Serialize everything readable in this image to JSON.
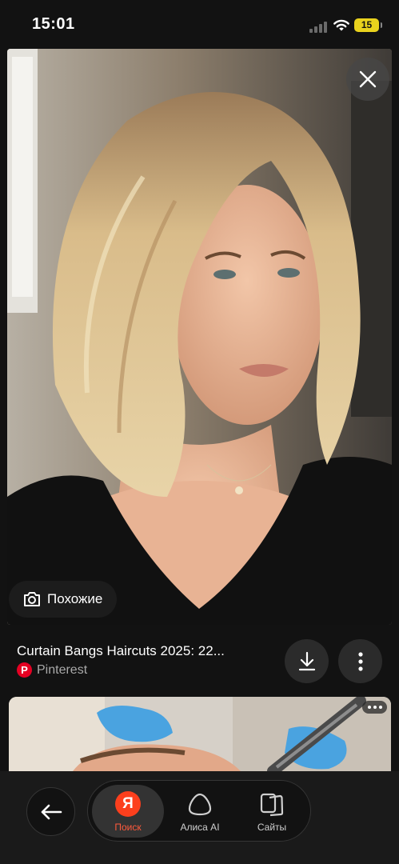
{
  "status_bar": {
    "time": "15:01",
    "battery": "15",
    "battery_color": "#e9d21d"
  },
  "viewer": {
    "image_alt": "Curtain Bangs Haircuts 2025",
    "close_icon": "close-icon",
    "similar_label": "Похожие",
    "similar_icon": "camera-lens-icon"
  },
  "caption": {
    "title": "Curtain Bangs Haircuts 2025: 22...",
    "source": "Pinterest",
    "source_color": "#e60023",
    "download_icon": "download-icon",
    "more_icon": "more-vertical-icon"
  },
  "next_card": {
    "more_icon": "more-horizontal-icon"
  },
  "bottom_nav": {
    "back_icon": "arrow-left-icon",
    "items": [
      {
        "label": "Поиск",
        "icon": "Я",
        "active": true
      },
      {
        "label": "Алиса AI",
        "icon": "alice-icon",
        "active": false
      },
      {
        "label": "Сайты",
        "icon": "sites-icon",
        "active": false
      }
    ],
    "accent": "#ff5a3c"
  }
}
